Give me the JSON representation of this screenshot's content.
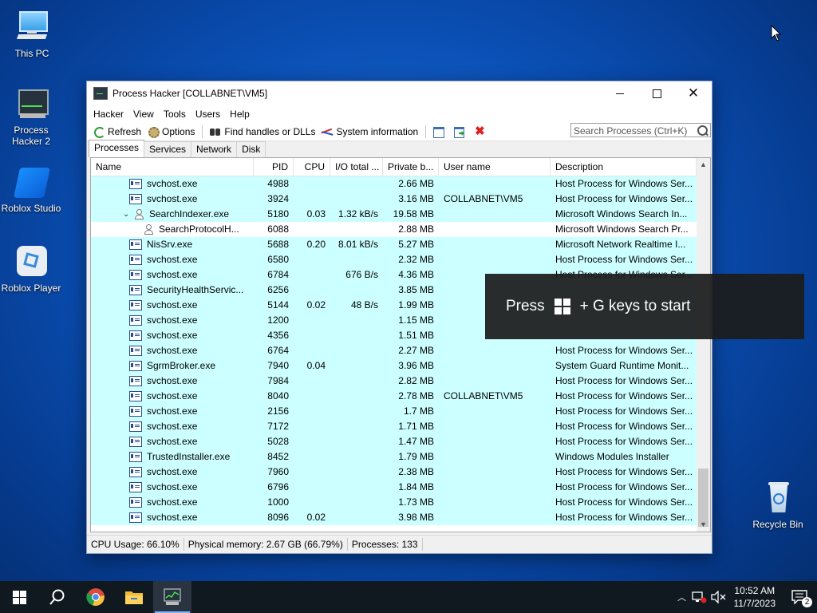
{
  "desktop": {
    "icons": [
      {
        "label": "This PC"
      },
      {
        "label": "Process Hacker 2"
      },
      {
        "label": "Roblox Studio"
      },
      {
        "label": "Roblox Player"
      },
      {
        "label": "Recycle Bin"
      }
    ]
  },
  "window": {
    "title": "Process Hacker [COLLABNET\\VM5]",
    "menu": [
      "Hacker",
      "View",
      "Tools",
      "Users",
      "Help"
    ],
    "toolbar": {
      "refresh": "Refresh",
      "options": "Options",
      "find_handles": "Find handles or DLLs",
      "system_info": "System information"
    },
    "search_placeholder": "Search Processes (Ctrl+K)",
    "tabs": [
      "Processes",
      "Services",
      "Network",
      "Disk"
    ],
    "columns": [
      "Name",
      "PID",
      "CPU",
      "I/O total ...",
      "Private b...",
      "User name",
      "Description"
    ],
    "rows": [
      {
        "name": "svchost.exe",
        "pid": "4988",
        "cpu": "",
        "io": "",
        "pb": "2.66 MB",
        "user": "",
        "desc": "Host Process for Windows Ser..."
      },
      {
        "name": "svchost.exe",
        "pid": "3924",
        "cpu": "",
        "io": "",
        "pb": "3.16 MB",
        "user": "COLLABNET\\VM5",
        "desc": "Host Process for Windows Ser..."
      },
      {
        "name": "SearchIndexer.exe",
        "pid": "5180",
        "cpu": "0.03",
        "io": "1.32 kB/s",
        "pb": "19.58 MB",
        "user": "",
        "desc": "Microsoft Windows Search In..."
      },
      {
        "name": "SearchProtocolH...",
        "pid": "6088",
        "cpu": "",
        "io": "",
        "pb": "2.88 MB",
        "user": "",
        "desc": "Microsoft Windows Search Pr..."
      },
      {
        "name": "NisSrv.exe",
        "pid": "5688",
        "cpu": "0.20",
        "io": "8.01 kB/s",
        "pb": "5.27 MB",
        "user": "",
        "desc": "Microsoft Network Realtime I..."
      },
      {
        "name": "svchost.exe",
        "pid": "6580",
        "cpu": "",
        "io": "",
        "pb": "2.32 MB",
        "user": "",
        "desc": "Host Process for Windows Ser..."
      },
      {
        "name": "svchost.exe",
        "pid": "6784",
        "cpu": "",
        "io": "676 B/s",
        "pb": "4.36 MB",
        "user": "",
        "desc": "Host Process for Windows Ser..."
      },
      {
        "name": "SecurityHealthServic...",
        "pid": "6256",
        "cpu": "",
        "io": "",
        "pb": "3.85 MB",
        "user": "",
        "desc": ""
      },
      {
        "name": "svchost.exe",
        "pid": "5144",
        "cpu": "0.02",
        "io": "48 B/s",
        "pb": "1.99 MB",
        "user": "",
        "desc": ""
      },
      {
        "name": "svchost.exe",
        "pid": "1200",
        "cpu": "",
        "io": "",
        "pb": "1.15 MB",
        "user": "",
        "desc": ""
      },
      {
        "name": "svchost.exe",
        "pid": "4356",
        "cpu": "",
        "io": "",
        "pb": "1.51 MB",
        "user": "",
        "desc": ""
      },
      {
        "name": "svchost.exe",
        "pid": "6764",
        "cpu": "",
        "io": "",
        "pb": "2.27 MB",
        "user": "",
        "desc": "Host Process for Windows Ser..."
      },
      {
        "name": "SgrmBroker.exe",
        "pid": "7940",
        "cpu": "0.04",
        "io": "",
        "pb": "3.96 MB",
        "user": "",
        "desc": "System Guard Runtime Monit..."
      },
      {
        "name": "svchost.exe",
        "pid": "7984",
        "cpu": "",
        "io": "",
        "pb": "2.82 MB",
        "user": "",
        "desc": "Host Process for Windows Ser..."
      },
      {
        "name": "svchost.exe",
        "pid": "8040",
        "cpu": "",
        "io": "",
        "pb": "2.78 MB",
        "user": "COLLABNET\\VM5",
        "desc": "Host Process for Windows Ser..."
      },
      {
        "name": "svchost.exe",
        "pid": "2156",
        "cpu": "",
        "io": "",
        "pb": "1.7 MB",
        "user": "",
        "desc": "Host Process for Windows Ser..."
      },
      {
        "name": "svchost.exe",
        "pid": "7172",
        "cpu": "",
        "io": "",
        "pb": "1.71 MB",
        "user": "",
        "desc": "Host Process for Windows Ser..."
      },
      {
        "name": "svchost.exe",
        "pid": "5028",
        "cpu": "",
        "io": "",
        "pb": "1.47 MB",
        "user": "",
        "desc": "Host Process for Windows Ser..."
      },
      {
        "name": "TrustedInstaller.exe",
        "pid": "8452",
        "cpu": "",
        "io": "",
        "pb": "1.79 MB",
        "user": "",
        "desc": "Windows Modules Installer"
      },
      {
        "name": "svchost.exe",
        "pid": "7960",
        "cpu": "",
        "io": "",
        "pb": "2.38 MB",
        "user": "",
        "desc": "Host Process for Windows Ser..."
      },
      {
        "name": "svchost.exe",
        "pid": "6796",
        "cpu": "",
        "io": "",
        "pb": "1.84 MB",
        "user": "",
        "desc": "Host Process for Windows Ser..."
      },
      {
        "name": "svchost.exe",
        "pid": "1000",
        "cpu": "",
        "io": "",
        "pb": "1.73 MB",
        "user": "",
        "desc": "Host Process for Windows Ser..."
      },
      {
        "name": "svchost.exe",
        "pid": "8096",
        "cpu": "0.02",
        "io": "",
        "pb": "3.98 MB",
        "user": "",
        "desc": "Host Process for Windows Ser..."
      }
    ],
    "status": {
      "cpu": "CPU Usage: 66.10%",
      "memory": "Physical memory: 2.67 GB (66.79%)",
      "processes": "Processes: 133"
    }
  },
  "overlay": {
    "before": "Press",
    "after": "+ G keys to start"
  },
  "taskbar": {
    "time": "10:52 AM",
    "date": "11/7/2023",
    "notification_count": "2"
  },
  "colors": {
    "row_highlight": "#ccffff",
    "taskbar": "#101820"
  }
}
